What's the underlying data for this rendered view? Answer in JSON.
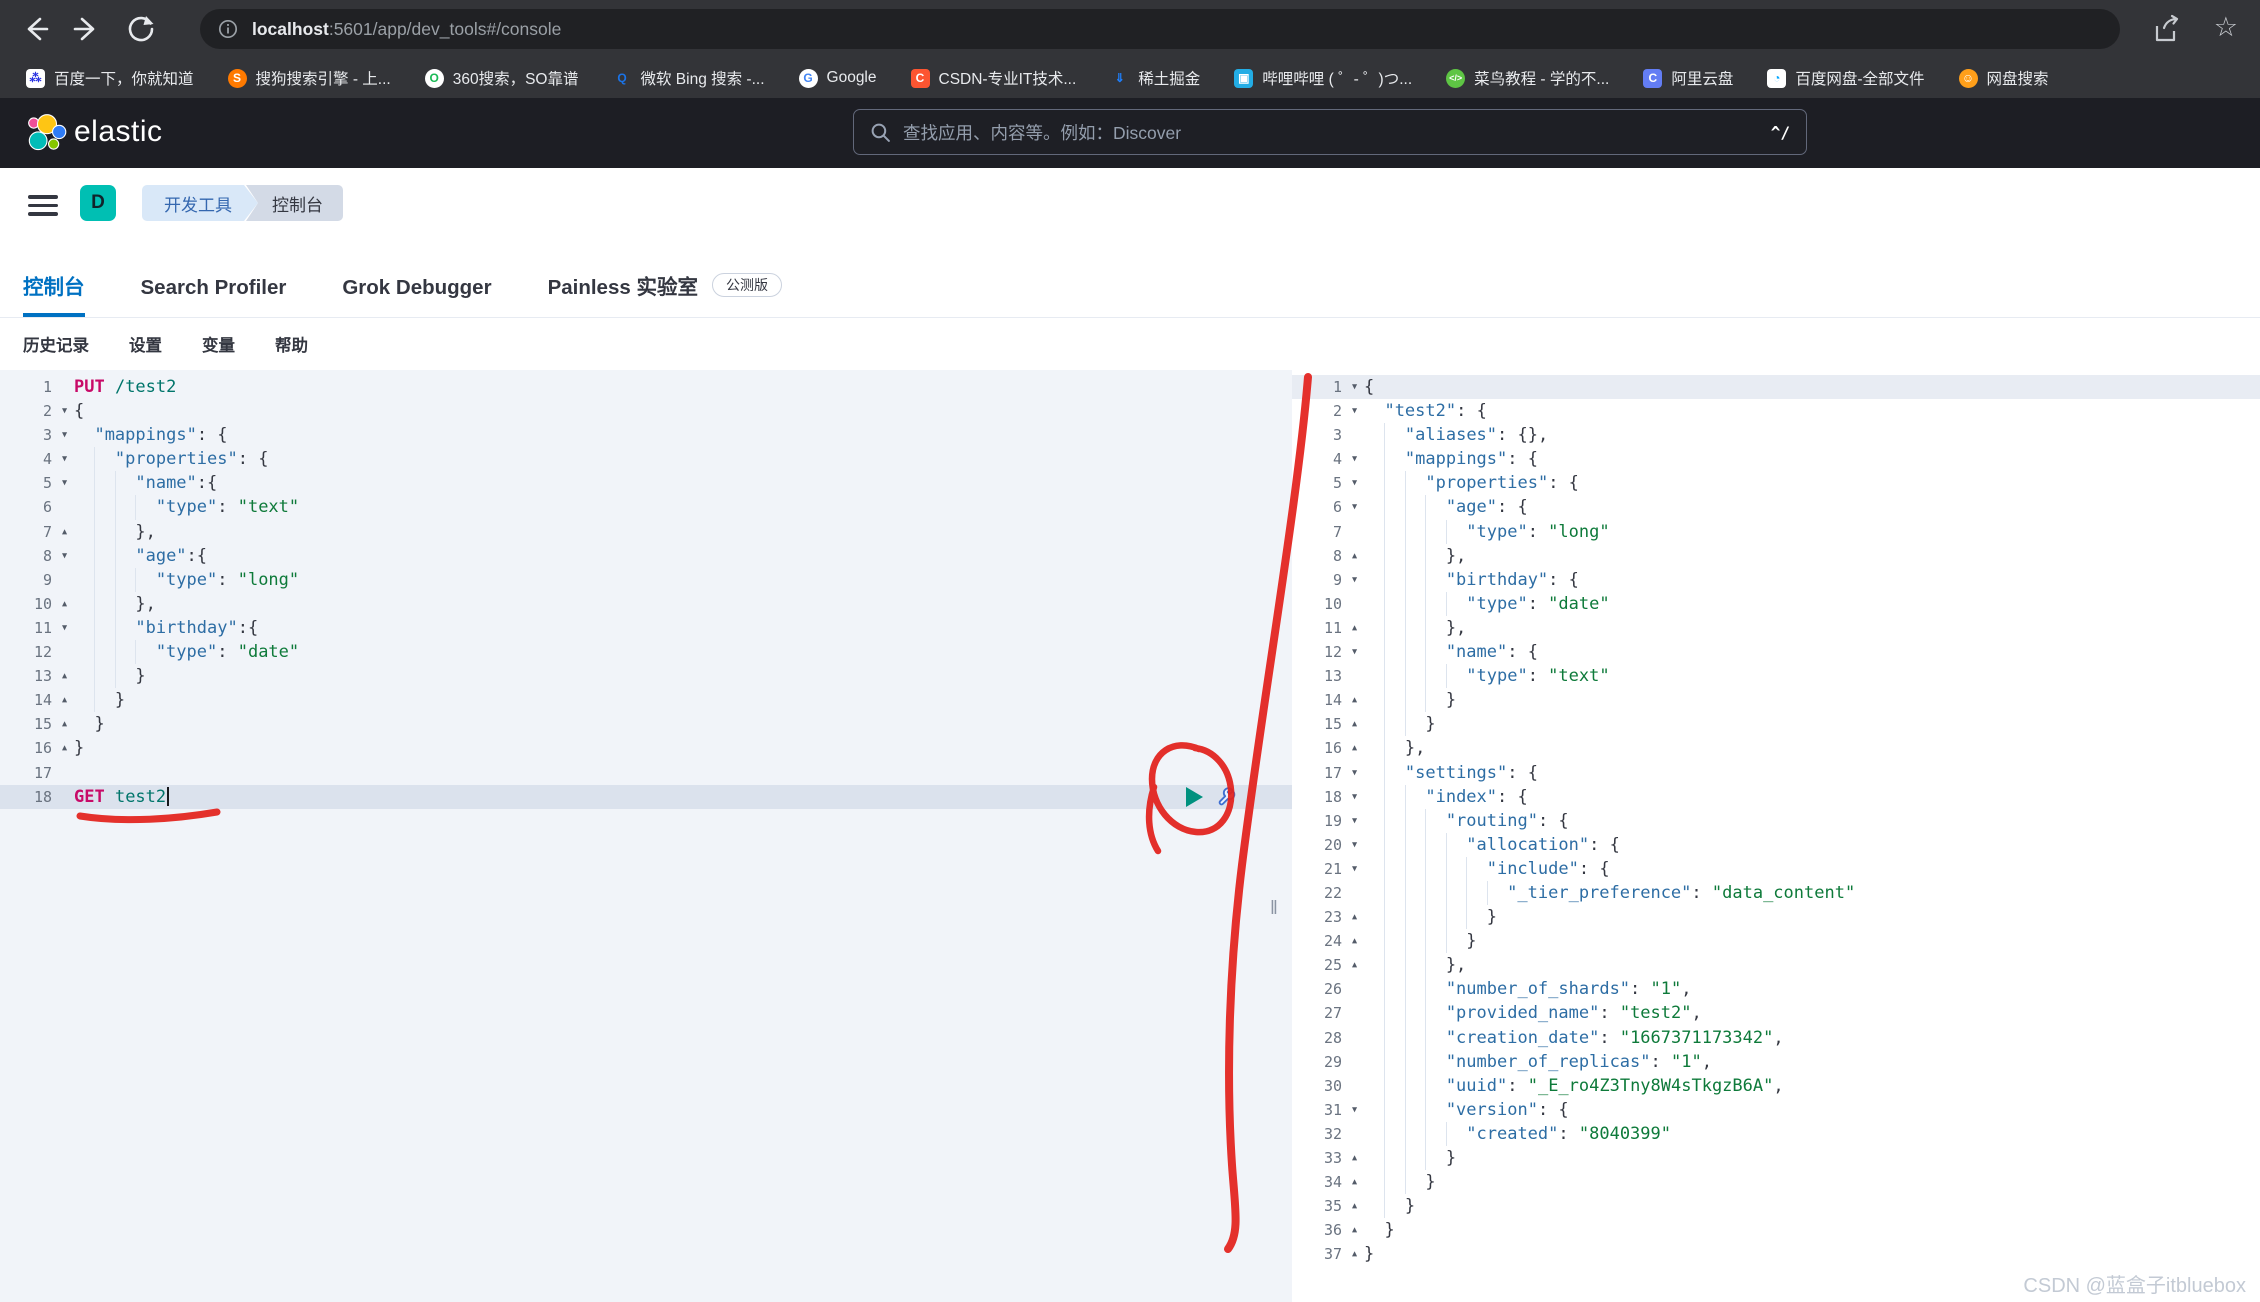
{
  "browser": {
    "url_host": "localhost",
    "url_path": ":5601/app/dev_tools#/console",
    "nav": {
      "back": "back-arrow",
      "forward": "forward-arrow",
      "reload": "reload",
      "share": "share",
      "bookmark_star": "☆"
    },
    "bookmarks": [
      {
        "label": "百度一下，你就知道",
        "fav": {
          "bg": "#ffffff",
          "fg": "#2932e1",
          "glyph": "⁂",
          "shape": "square"
        }
      },
      {
        "label": "搜狗搜索引擎 - 上...",
        "fav": {
          "bg": "#ff7a00",
          "fg": "#ffffff",
          "glyph": "S",
          "shape": "circle"
        }
      },
      {
        "label": "360搜索，SO靠谱",
        "fav": {
          "bg": "#ffffff",
          "fg": "#19b955",
          "glyph": "O",
          "shape": "circle"
        }
      },
      {
        "label": "微软 Bing 搜索 -...",
        "fav": {
          "bg": "transparent",
          "fg": "#1a73e8",
          "glyph": "Q",
          "shape": "circle"
        }
      },
      {
        "label": "Google",
        "fav": {
          "bg": "#ffffff",
          "fg": "#4285f4",
          "glyph": "G",
          "shape": "circle"
        }
      },
      {
        "label": "CSDN-专业IT技术...",
        "fav": {
          "bg": "#fc5531",
          "fg": "#ffffff",
          "glyph": "C",
          "shape": "square"
        }
      },
      {
        "label": "稀土掘金",
        "fav": {
          "bg": "transparent",
          "fg": "#1e80ff",
          "glyph": "⇓",
          "shape": "square"
        }
      },
      {
        "label": "哔哩哔哩 ( ゜- ゜)つ...",
        "fav": {
          "bg": "#23ade5",
          "fg": "#ffffff",
          "glyph": "▣",
          "shape": "square"
        }
      },
      {
        "label": "菜鸟教程 - 学的不...",
        "fav": {
          "bg": "#5ec544",
          "fg": "#ffffff",
          "glyph": "</>",
          "shape": "circle"
        }
      },
      {
        "label": "阿里云盘",
        "fav": {
          "bg": "#637df4",
          "fg": "#ffffff",
          "glyph": "C",
          "shape": "square"
        }
      },
      {
        "label": "百度网盘-全部文件",
        "fav": {
          "bg": "#ffffff",
          "fg": "#06a7ff",
          "glyph": "◔",
          "shape": "square"
        }
      },
      {
        "label": "网盘搜索",
        "fav": {
          "bg": "#ff9f1a",
          "fg": "#ffffff",
          "glyph": "☺",
          "shape": "circle"
        }
      }
    ]
  },
  "header": {
    "brand": "elastic",
    "search_placeholder": "查找应用、内容等。例如：Discover",
    "search_shortcut": "^/"
  },
  "breadcrumb": {
    "avatar": "D",
    "items": [
      "开发工具",
      "控制台"
    ]
  },
  "tabs": [
    {
      "label": "控制台",
      "active": true
    },
    {
      "label": "Search Profiler"
    },
    {
      "label": "Grok Debugger"
    },
    {
      "label": "Painless 实验室",
      "badge": "公测版"
    }
  ],
  "menu": [
    "历史记录",
    "设置",
    "变量",
    "帮助"
  ],
  "console": {
    "divider_handle": "‖",
    "editor": {
      "lines": [
        {
          "n": 1,
          "i": 0,
          "s": [
            [
              "m",
              "PUT "
            ],
            [
              "u",
              "/test2"
            ]
          ]
        },
        {
          "n": 2,
          "f": "o",
          "i": 0,
          "s": [
            [
              "p",
              "{"
            ]
          ]
        },
        {
          "n": 3,
          "f": "o",
          "i": 1,
          "s": [
            [
              "k",
              "\"mappings\""
            ],
            [
              "p",
              ": {"
            ]
          ]
        },
        {
          "n": 4,
          "f": "o",
          "i": 2,
          "s": [
            [
              "k",
              "\"properties\""
            ],
            [
              "p",
              ": {"
            ]
          ]
        },
        {
          "n": 5,
          "f": "o",
          "i": 3,
          "s": [
            [
              "k",
              "\"name\""
            ],
            [
              "p",
              ":{"
            ]
          ]
        },
        {
          "n": 6,
          "i": 4,
          "s": [
            [
              "k",
              "\"type\""
            ],
            [
              "p",
              ": "
            ],
            [
              "v",
              "\"text\""
            ]
          ]
        },
        {
          "n": 7,
          "f": "c",
          "i": 3,
          "s": [
            [
              "p",
              "},"
            ]
          ]
        },
        {
          "n": 8,
          "f": "o",
          "i": 3,
          "s": [
            [
              "k",
              "\"age\""
            ],
            [
              "p",
              ":{"
            ]
          ]
        },
        {
          "n": 9,
          "i": 4,
          "s": [
            [
              "k",
              "\"type\""
            ],
            [
              "p",
              ": "
            ],
            [
              "v",
              "\"long\""
            ]
          ]
        },
        {
          "n": 10,
          "f": "c",
          "i": 3,
          "s": [
            [
              "p",
              "},"
            ]
          ]
        },
        {
          "n": 11,
          "f": "o",
          "i": 3,
          "s": [
            [
              "k",
              "\"birthday\""
            ],
            [
              "p",
              ":{"
            ]
          ]
        },
        {
          "n": 12,
          "i": 4,
          "s": [
            [
              "k",
              "\"type\""
            ],
            [
              "p",
              ": "
            ],
            [
              "v",
              "\"date\""
            ]
          ]
        },
        {
          "n": 13,
          "f": "c",
          "i": 3,
          "s": [
            [
              "p",
              "}"
            ]
          ]
        },
        {
          "n": 14,
          "f": "c",
          "i": 2,
          "s": [
            [
              "p",
              "}"
            ]
          ]
        },
        {
          "n": 15,
          "f": "c",
          "i": 1,
          "s": [
            [
              "p",
              "}"
            ]
          ]
        },
        {
          "n": 16,
          "f": "c",
          "i": 0,
          "s": [
            [
              "p",
              "}"
            ]
          ]
        },
        {
          "n": 17,
          "i": 0,
          "s": []
        },
        {
          "n": 18,
          "i": 0,
          "hl": true,
          "cur": true,
          "s": [
            [
              "m",
              "GET "
            ],
            [
              "u",
              "test2"
            ]
          ]
        }
      ]
    },
    "response": {
      "lines": [
        {
          "n": 1,
          "f": "o",
          "i": 0,
          "hl": true,
          "s": [
            [
              "p",
              "{"
            ]
          ]
        },
        {
          "n": 2,
          "f": "o",
          "i": 1,
          "s": [
            [
              "k",
              "\"test2\""
            ],
            [
              "p",
              ": {"
            ]
          ]
        },
        {
          "n": 3,
          "i": 2,
          "s": [
            [
              "k",
              "\"aliases\""
            ],
            [
              "p",
              ": {},"
            ]
          ]
        },
        {
          "n": 4,
          "f": "o",
          "i": 2,
          "s": [
            [
              "k",
              "\"mappings\""
            ],
            [
              "p",
              ": {"
            ]
          ]
        },
        {
          "n": 5,
          "f": "o",
          "i": 3,
          "s": [
            [
              "k",
              "\"properties\""
            ],
            [
              "p",
              ": {"
            ]
          ]
        },
        {
          "n": 6,
          "f": "o",
          "i": 4,
          "s": [
            [
              "k",
              "\"age\""
            ],
            [
              "p",
              ": {"
            ]
          ]
        },
        {
          "n": 7,
          "i": 5,
          "s": [
            [
              "k",
              "\"type\""
            ],
            [
              "p",
              ": "
            ],
            [
              "v",
              "\"long\""
            ]
          ]
        },
        {
          "n": 8,
          "f": "c",
          "i": 4,
          "s": [
            [
              "p",
              "},"
            ]
          ]
        },
        {
          "n": 9,
          "f": "o",
          "i": 4,
          "s": [
            [
              "k",
              "\"birthday\""
            ],
            [
              "p",
              ": {"
            ]
          ]
        },
        {
          "n": 10,
          "i": 5,
          "s": [
            [
              "k",
              "\"type\""
            ],
            [
              "p",
              ": "
            ],
            [
              "v",
              "\"date\""
            ]
          ]
        },
        {
          "n": 11,
          "f": "c",
          "i": 4,
          "s": [
            [
              "p",
              "},"
            ]
          ]
        },
        {
          "n": 12,
          "f": "o",
          "i": 4,
          "s": [
            [
              "k",
              "\"name\""
            ],
            [
              "p",
              ": {"
            ]
          ]
        },
        {
          "n": 13,
          "i": 5,
          "s": [
            [
              "k",
              "\"type\""
            ],
            [
              "p",
              ": "
            ],
            [
              "v",
              "\"text\""
            ]
          ]
        },
        {
          "n": 14,
          "f": "c",
          "i": 4,
          "s": [
            [
              "p",
              "}"
            ]
          ]
        },
        {
          "n": 15,
          "f": "c",
          "i": 3,
          "s": [
            [
              "p",
              "}"
            ]
          ]
        },
        {
          "n": 16,
          "f": "c",
          "i": 2,
          "s": [
            [
              "p",
              "},"
            ]
          ]
        },
        {
          "n": 17,
          "f": "o",
          "i": 2,
          "s": [
            [
              "k",
              "\"settings\""
            ],
            [
              "p",
              ": {"
            ]
          ]
        },
        {
          "n": 18,
          "f": "o",
          "i": 3,
          "s": [
            [
              "k",
              "\"index\""
            ],
            [
              "p",
              ": {"
            ]
          ]
        },
        {
          "n": 19,
          "f": "o",
          "i": 4,
          "s": [
            [
              "k",
              "\"routing\""
            ],
            [
              "p",
              ": {"
            ]
          ]
        },
        {
          "n": 20,
          "f": "o",
          "i": 5,
          "s": [
            [
              "k",
              "\"allocation\""
            ],
            [
              "p",
              ": {"
            ]
          ]
        },
        {
          "n": 21,
          "f": "o",
          "i": 6,
          "s": [
            [
              "k",
              "\"include\""
            ],
            [
              "p",
              ": {"
            ]
          ]
        },
        {
          "n": 22,
          "i": 7,
          "s": [
            [
              "k",
              "\"_tier_preference\""
            ],
            [
              "p",
              ": "
            ],
            [
              "v",
              "\"data_content\""
            ]
          ]
        },
        {
          "n": 23,
          "f": "c",
          "i": 6,
          "s": [
            [
              "p",
              "}"
            ]
          ]
        },
        {
          "n": 24,
          "f": "c",
          "i": 5,
          "s": [
            [
              "p",
              "}"
            ]
          ]
        },
        {
          "n": 25,
          "f": "c",
          "i": 4,
          "s": [
            [
              "p",
              "},"
            ]
          ]
        },
        {
          "n": 26,
          "i": 4,
          "s": [
            [
              "k",
              "\"number_of_shards\""
            ],
            [
              "p",
              ": "
            ],
            [
              "v",
              "\"1\""
            ],
            [
              "p",
              ","
            ]
          ]
        },
        {
          "n": 27,
          "i": 4,
          "s": [
            [
              "k",
              "\"provided_name\""
            ],
            [
              "p",
              ": "
            ],
            [
              "v",
              "\"test2\""
            ],
            [
              "p",
              ","
            ]
          ]
        },
        {
          "n": 28,
          "i": 4,
          "s": [
            [
              "k",
              "\"creation_date\""
            ],
            [
              "p",
              ": "
            ],
            [
              "v",
              "\"1667371173342\""
            ],
            [
              "p",
              ","
            ]
          ]
        },
        {
          "n": 29,
          "i": 4,
          "s": [
            [
              "k",
              "\"number_of_replicas\""
            ],
            [
              "p",
              ": "
            ],
            [
              "v",
              "\"1\""
            ],
            [
              "p",
              ","
            ]
          ]
        },
        {
          "n": 30,
          "i": 4,
          "s": [
            [
              "k",
              "\"uuid\""
            ],
            [
              "p",
              ": "
            ],
            [
              "v",
              "\"_E_ro4Z3Tny8W4sTkgzB6A\""
            ],
            [
              "p",
              ","
            ]
          ]
        },
        {
          "n": 31,
          "f": "o",
          "i": 4,
          "s": [
            [
              "k",
              "\"version\""
            ],
            [
              "p",
              ": {"
            ]
          ]
        },
        {
          "n": 32,
          "i": 5,
          "s": [
            [
              "k",
              "\"created\""
            ],
            [
              "p",
              ": "
            ],
            [
              "v",
              "\"8040399\""
            ]
          ]
        },
        {
          "n": 33,
          "f": "c",
          "i": 4,
          "s": [
            [
              "p",
              "}"
            ]
          ]
        },
        {
          "n": 34,
          "f": "c",
          "i": 3,
          "s": [
            [
              "p",
              "}"
            ]
          ]
        },
        {
          "n": 35,
          "f": "c",
          "i": 2,
          "s": [
            [
              "p",
              "}"
            ]
          ]
        },
        {
          "n": 36,
          "f": "c",
          "i": 1,
          "s": [
            [
              "p",
              "}"
            ]
          ]
        },
        {
          "n": 37,
          "f": "c",
          "i": 0,
          "s": [
            [
              "p",
              "}"
            ]
          ]
        }
      ]
    }
  },
  "watermark": "CSDN @蓝盒子itbluebox",
  "colors": {
    "accent_blue": "#0071c2",
    "avatar_teal": "#00bfb3",
    "annotation_red": "#e3211c",
    "code_method": "#c80a68",
    "code_url": "#00756b",
    "code_key": "#2d6da4",
    "code_string": "#0e7a3a",
    "code_punct": "#343741",
    "play_button": "#00917f"
  }
}
